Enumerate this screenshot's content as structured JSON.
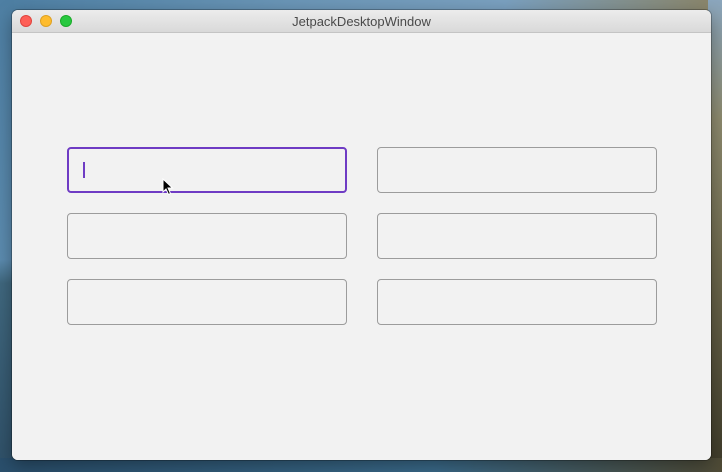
{
  "window": {
    "title": "JetpackDesktopWindow"
  },
  "colors": {
    "focus_accent": "#6f3cc4",
    "field_border": "#9c9c9c",
    "background": "#f2f2f2"
  },
  "form": {
    "focused_field": "field-1",
    "fields": [
      {
        "id": "field-1",
        "value": "",
        "focused": true
      },
      {
        "id": "field-2",
        "value": "",
        "focused": false
      },
      {
        "id": "field-3",
        "value": "",
        "focused": false
      },
      {
        "id": "field-4",
        "value": "",
        "focused": false
      },
      {
        "id": "field-5",
        "value": "",
        "focused": false
      },
      {
        "id": "field-6",
        "value": "",
        "focused": false
      }
    ]
  },
  "icons": {
    "close": "close-icon",
    "minimize": "minimize-icon",
    "maximize": "maximize-icon",
    "pointer": "mouse-pointer-icon"
  }
}
